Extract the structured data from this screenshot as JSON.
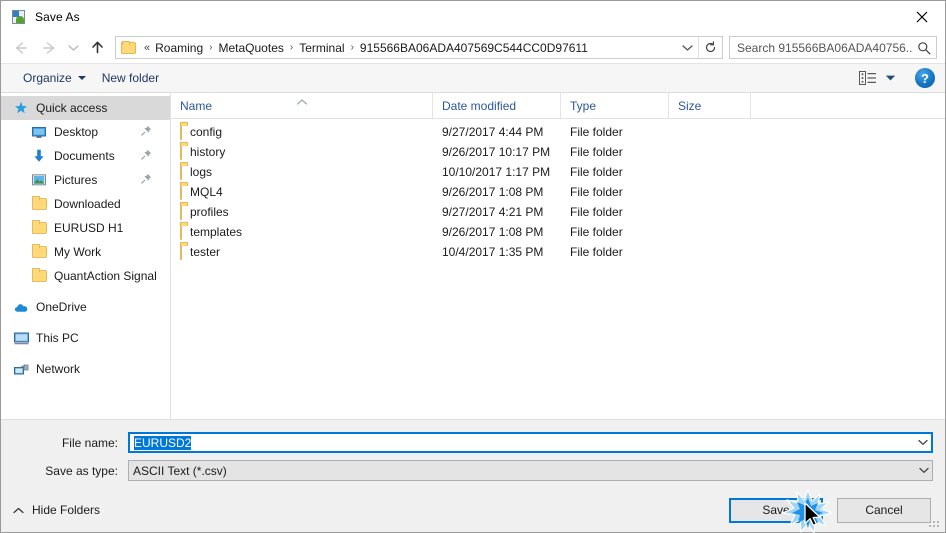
{
  "window": {
    "title": "Save As",
    "title_icon": "save-as-icon",
    "close_label": "✕"
  },
  "nav": {
    "back_icon": "arrow-left-icon",
    "forward_icon": "arrow-right-icon",
    "recent_icon": "chevron-down-icon",
    "up_icon": "arrow-up-icon",
    "breadcrumb_prefix": "«",
    "breadcrumbs": [
      {
        "label": "Roaming"
      },
      {
        "label": "MetaQuotes"
      },
      {
        "label": "Terminal"
      },
      {
        "label": "915566BA06ADA407569C544CC0D97611"
      }
    ],
    "separator": "›",
    "dropdown_icon": "chevron-down-icon",
    "refresh_icon": "refresh-icon"
  },
  "search": {
    "placeholder": "Search 915566BA06ADA40756...",
    "icon": "search-icon"
  },
  "toolbar": {
    "organize_label": "Organize",
    "new_folder_label": "New folder",
    "view_icon": "view-layout-icon",
    "view_caret_icon": "chevron-down-icon",
    "help_label": "?"
  },
  "sidebar": {
    "items": [
      {
        "label": "Quick access",
        "icon": "star-icon",
        "level": 0,
        "selected": true,
        "pinned": false
      },
      {
        "label": "Desktop",
        "icon": "desktop-icon",
        "level": 1,
        "selected": false,
        "pinned": true
      },
      {
        "label": "Documents",
        "icon": "documents-icon",
        "level": 1,
        "selected": false,
        "pinned": true
      },
      {
        "label": "Pictures",
        "icon": "pictures-icon",
        "level": 1,
        "selected": false,
        "pinned": true
      },
      {
        "label": "Downloaded",
        "icon": "folder-icon",
        "level": 1,
        "selected": false,
        "pinned": false
      },
      {
        "label": "EURUSD H1",
        "icon": "folder-icon",
        "level": 1,
        "selected": false,
        "pinned": false
      },
      {
        "label": "My Work",
        "icon": "folder-icon",
        "level": 1,
        "selected": false,
        "pinned": false
      },
      {
        "label": "QuantAction Signal",
        "icon": "folder-icon",
        "level": 1,
        "selected": false,
        "pinned": false
      },
      {
        "label": "OneDrive",
        "icon": "onedrive-icon",
        "level": 0,
        "selected": false,
        "pinned": false,
        "gap_before": true
      },
      {
        "label": "This PC",
        "icon": "computer-icon",
        "level": 0,
        "selected": false,
        "pinned": false,
        "gap_before": true
      },
      {
        "label": "Network",
        "icon": "network-icon",
        "level": 0,
        "selected": false,
        "pinned": false,
        "gap_before": true
      }
    ]
  },
  "filelist": {
    "columns": [
      {
        "key": "name",
        "label": "Name",
        "sorted": true,
        "sort_dir": "asc"
      },
      {
        "key": "date",
        "label": "Date modified",
        "sorted": false
      },
      {
        "key": "type",
        "label": "Type",
        "sorted": false
      },
      {
        "key": "size",
        "label": "Size",
        "sorted": false
      }
    ],
    "rows": [
      {
        "name": "config",
        "date": "9/27/2017 4:44 PM",
        "type": "File folder",
        "size": "",
        "icon": "folder-icon"
      },
      {
        "name": "history",
        "date": "9/26/2017 10:17 PM",
        "type": "File folder",
        "size": "",
        "icon": "folder-icon"
      },
      {
        "name": "logs",
        "date": "10/10/2017 1:17 PM",
        "type": "File folder",
        "size": "",
        "icon": "folder-icon"
      },
      {
        "name": "MQL4",
        "date": "9/26/2017 1:08 PM",
        "type": "File folder",
        "size": "",
        "icon": "folder-icon"
      },
      {
        "name": "profiles",
        "date": "9/27/2017 4:21 PM",
        "type": "File folder",
        "size": "",
        "icon": "folder-icon"
      },
      {
        "name": "templates",
        "date": "9/26/2017 1:08 PM",
        "type": "File folder",
        "size": "",
        "icon": "folder-icon"
      },
      {
        "name": "tester",
        "date": "10/4/2017 1:35 PM",
        "type": "File folder",
        "size": "",
        "icon": "folder-icon"
      }
    ]
  },
  "form": {
    "filename_label": "File name:",
    "filename_value": "EURUSD2",
    "filename_selected": true,
    "savetype_label": "Save as type:",
    "savetype_value": "ASCII Text (*.csv)",
    "dropdown_icon": "chevron-down-icon"
  },
  "footer": {
    "hide_folders_label": "Hide Folders",
    "hide_folders_icon": "chevron-up-icon",
    "save_label": "Save",
    "cancel_label": "Cancel",
    "resize_grip_icon": "resize-grip-icon",
    "cursor_icon": "mouse-pointer-icon",
    "click_effect_icon": "click-burst-icon"
  },
  "colors": {
    "accent": "#0078d7",
    "selection": "#0078d7",
    "header_text": "#2b579a",
    "toolbar_text": "#1f3864",
    "folder": "#ffd977",
    "sidebar_selected": "#d9d9d9"
  }
}
